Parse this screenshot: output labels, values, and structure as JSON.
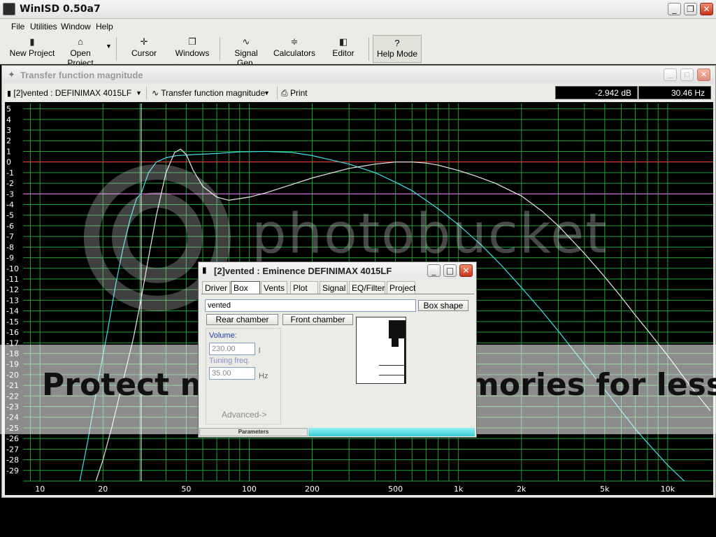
{
  "app": {
    "title": "WinISD 0.50a7"
  },
  "menu": {
    "file": "File",
    "utilities": "Utilities",
    "window": "Window",
    "help": "Help"
  },
  "toolbar": {
    "new_project": "New Project",
    "open_project": "Open Project",
    "cursor": "Cursor",
    "windows": "Windows",
    "signal_gen": "Signal Gen.",
    "calculators": "Calculators",
    "editor": "Editor",
    "help_mode": "Help Mode",
    "help_icon": "?"
  },
  "child": {
    "title": "Transfer function magnitude",
    "project_select": "[2]vented : DEFINIMAX 4015LF",
    "graph_select": "Transfer function magnitude",
    "print": "Print",
    "readout_db": "-2.942 dB",
    "readout_hz": "30.46 Hz"
  },
  "chart_data": {
    "type": "line",
    "title": "",
    "xlabel": "",
    "ylabel": "",
    "x_scale": "log",
    "xlim": [
      8.3,
      16500
    ],
    "ylim": [
      -30,
      5.5
    ],
    "y_ticks": [
      5,
      4,
      3,
      2,
      1,
      0,
      -1,
      -2,
      -3,
      -4,
      -5,
      -6,
      -7,
      -8,
      -9,
      -10,
      -11,
      -12,
      -13,
      -14,
      -15,
      -16,
      -17,
      -18,
      -19,
      -20,
      -21,
      -22,
      -23,
      -24,
      -25,
      -26,
      -27,
      -28,
      -29
    ],
    "x_ticks": [
      {
        "value": 10,
        "label": "10"
      },
      {
        "value": 20,
        "label": "20"
      },
      {
        "value": 50,
        "label": "50"
      },
      {
        "value": 100,
        "label": "100"
      },
      {
        "value": 200,
        "label": "200"
      },
      {
        "value": 500,
        "label": "500"
      },
      {
        "value": 1000,
        "label": "1k"
      },
      {
        "value": 2000,
        "label": "2k"
      },
      {
        "value": 5000,
        "label": "5k"
      },
      {
        "value": 10000,
        "label": "10k"
      }
    ],
    "grid": true,
    "reference_lines": [
      {
        "y": 0,
        "color": "#ff3030"
      },
      {
        "y": -3,
        "color": "#ff60ff"
      }
    ],
    "cursor_x": 30.46,
    "series": [
      {
        "color": "#40e0e0",
        "x": [
          15.5,
          17,
          19,
          21,
          23,
          25,
          27,
          29,
          30.5,
          33,
          36,
          40,
          45,
          55,
          70,
          90,
          120,
          160,
          200,
          300,
          400,
          500,
          600,
          700,
          800,
          1000,
          1300,
          1600,
          2000,
          2500,
          3000,
          4000,
          5000,
          6000,
          7000,
          8000,
          10000,
          12000,
          14000,
          16000
        ],
        "y": [
          -30,
          -26,
          -20.5,
          -16,
          -11.5,
          -8,
          -5.3,
          -3.4,
          -2.94,
          -1.0,
          0.0,
          0.4,
          0.6,
          0.7,
          0.8,
          0.95,
          1.0,
          0.9,
          0.6,
          -0.2,
          -1.0,
          -1.9,
          -2.7,
          -3.6,
          -4.4,
          -5.9,
          -7.9,
          -9.7,
          -11.8,
          -14.0,
          -15.9,
          -19.0,
          -21.4,
          -23.4,
          -25.1,
          -26.4,
          -28.5,
          -30.0,
          -31.0,
          -32.0
        ]
      },
      {
        "color": "#e8e8e8",
        "x": [
          18.5,
          20,
          22,
          25,
          28,
          30,
          33,
          36,
          40,
          44,
          47,
          50,
          54,
          60,
          70,
          80,
          100,
          120,
          150,
          200,
          300,
          400,
          500,
          550,
          600,
          700,
          800,
          1000,
          1200,
          1500,
          2000,
          2500,
          3000,
          4000,
          5000,
          6000,
          7000,
          8000,
          10000,
          12000,
          14000,
          16000
        ],
        "y": [
          -30,
          -28,
          -25,
          -20.5,
          -16.5,
          -13.5,
          -9.0,
          -5.0,
          -1.0,
          0.9,
          1.2,
          0.7,
          -0.8,
          -2.3,
          -3.3,
          -3.6,
          -3.3,
          -2.9,
          -2.3,
          -1.5,
          -0.6,
          -0.2,
          0.0,
          0.0,
          0.0,
          -0.1,
          -0.3,
          -0.8,
          -1.3,
          -2.0,
          -3.2,
          -4.6,
          -6.0,
          -8.6,
          -10.8,
          -12.7,
          -14.4,
          -15.8,
          -18.2,
          -20.3,
          -22.0,
          -23.4
        ]
      }
    ]
  },
  "watermark": {
    "brand": "photobucket",
    "tagline": "Protect more of your memories for less!"
  },
  "dialog": {
    "title": "[2]vented : Eminence DEFINIMAX 4015LF",
    "tabs": [
      "Driver",
      "Box",
      "Vents",
      "Plot",
      "Signal",
      "EQ/Filter",
      "Project"
    ],
    "box_name": "vented",
    "box_shape": "Box shape",
    "rear_chamber": "Rear chamber",
    "front_chamber": "Front chamber",
    "volume_label": "Volume:",
    "volume_value": "230.00",
    "volume_unit": "l",
    "tuning_label": "Tuning freq.",
    "tuning_value": "35.00",
    "tuning_unit": "Hz",
    "advanced": "Advanced->",
    "status_left": "Parameters"
  }
}
